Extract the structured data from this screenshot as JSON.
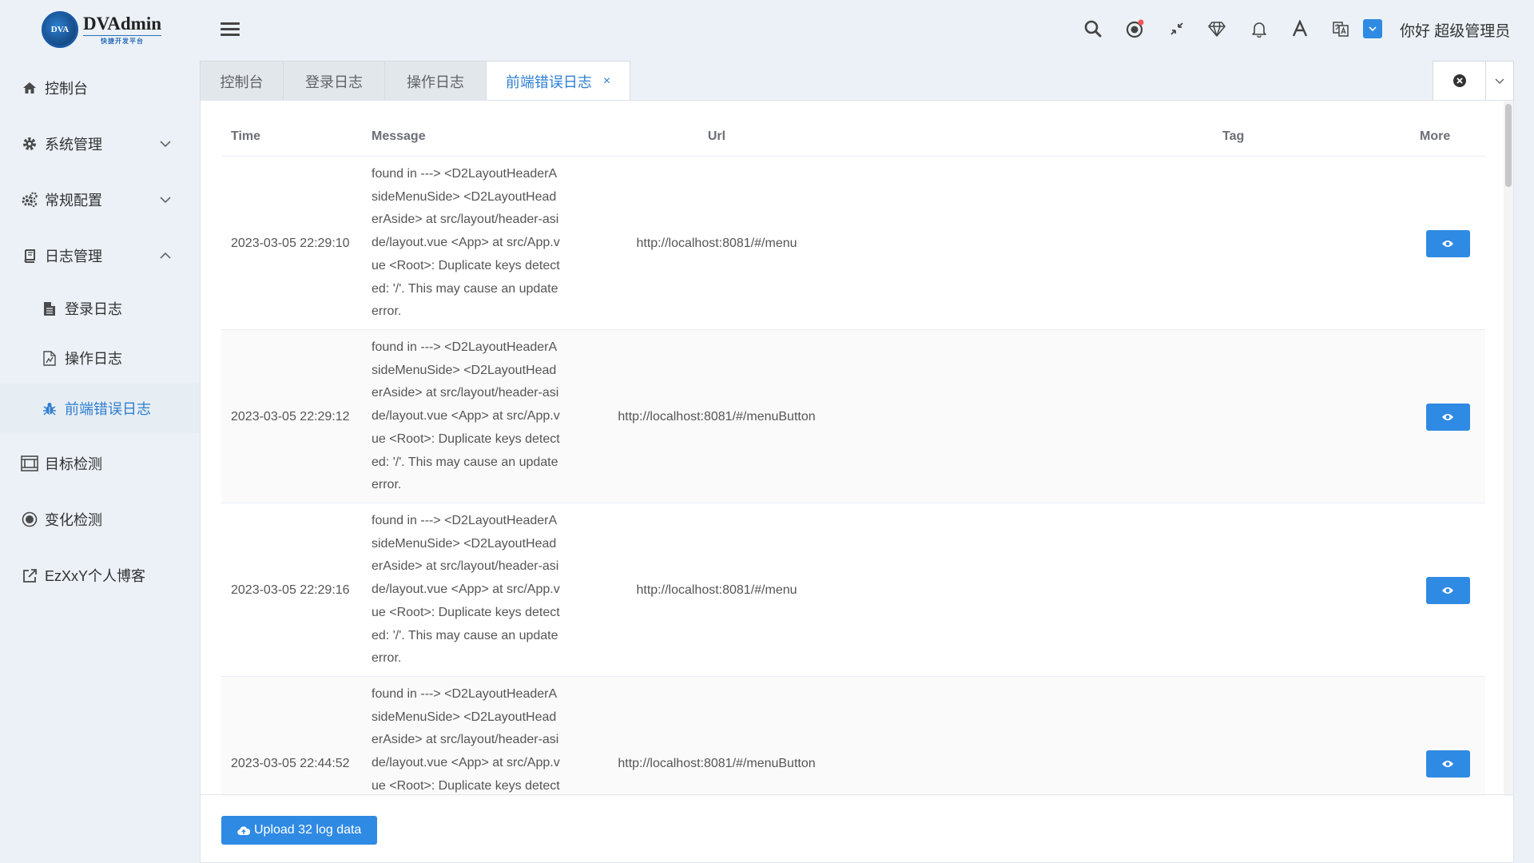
{
  "logo": {
    "mark": "DVA",
    "title": "DVAdmin",
    "subtitle": "快捷开发平台"
  },
  "sidebar": {
    "items": [
      {
        "label": "控制台",
        "icon": "home-icon"
      },
      {
        "label": "系统管理",
        "icon": "gear-icon",
        "expanded": false
      },
      {
        "label": "常规配置",
        "icon": "gears-icon",
        "expanded": false
      },
      {
        "label": "日志管理",
        "icon": "book-icon",
        "expanded": true
      },
      {
        "label": "登录日志",
        "icon": "file-text-icon"
      },
      {
        "label": "操作日志",
        "icon": "file-chart-icon"
      },
      {
        "label": "前端错误日志",
        "icon": "bug-icon",
        "active": true
      },
      {
        "label": "目标检测",
        "icon": "target-frame-icon"
      },
      {
        "label": "变化检测",
        "icon": "record-icon"
      },
      {
        "label": "EzXxY个人博客",
        "icon": "external-link-icon"
      }
    ]
  },
  "header": {
    "greeting": "你好 超级管理员",
    "icons": [
      "search-icon",
      "record-dot-icon",
      "compress-icon",
      "diamond-icon",
      "bell-icon",
      "font-size-icon",
      "translate-icon",
      "theme-dropdown-icon"
    ]
  },
  "tabs": [
    {
      "label": "控制台"
    },
    {
      "label": "登录日志"
    },
    {
      "label": "操作日志"
    },
    {
      "label": "前端错误日志",
      "active": true
    }
  ],
  "table": {
    "headers": {
      "time": "Time",
      "message": "Message",
      "url": "Url",
      "tag": "Tag",
      "more": "More"
    },
    "rows": [
      {
        "time": "2023-03-05 22:29:10",
        "message": "found in ---> <D2LayoutHeaderAsideMenuSide> <D2LayoutHeaderAside> at src/layout/header-aside/layout.vue <App> at src/App.vue <Root>: Duplicate keys detected: '/'. This may cause an update error.",
        "url": "http://localhost:8081/#/menu",
        "tag": ""
      },
      {
        "time": "2023-03-05 22:29:12",
        "message": "found in ---> <D2LayoutHeaderAsideMenuSide> <D2LayoutHeaderAside> at src/layout/header-aside/layout.vue <App> at src/App.vue <Root>: Duplicate keys detected: '/'. This may cause an update error.",
        "url": "http://localhost:8081/#/menuButton",
        "tag": ""
      },
      {
        "time": "2023-03-05 22:29:16",
        "message": "found in ---> <D2LayoutHeaderAsideMenuSide> <D2LayoutHeaderAside> at src/layout/header-aside/layout.vue <App> at src/App.vue <Root>: Duplicate keys detected: '/'. This may cause an update error.",
        "url": "http://localhost:8081/#/menu",
        "tag": ""
      },
      {
        "time": "2023-03-05 22:44:52",
        "message": "found in ---> <D2LayoutHeaderAsideMenuSide> <D2LayoutHeaderAside> at src/layout/header-aside/layout.vue <App> at src/App.vue <Root>: Duplicate keys detected: '/'. This may cause an update error.",
        "url": "http://localhost:8081/#/menuButton",
        "tag": ""
      }
    ]
  },
  "upload_button": "Upload 32 log data",
  "colors": {
    "accent": "#2f8ae3",
    "active_text": "#2f7fd1",
    "background": "#ebf1f6"
  }
}
